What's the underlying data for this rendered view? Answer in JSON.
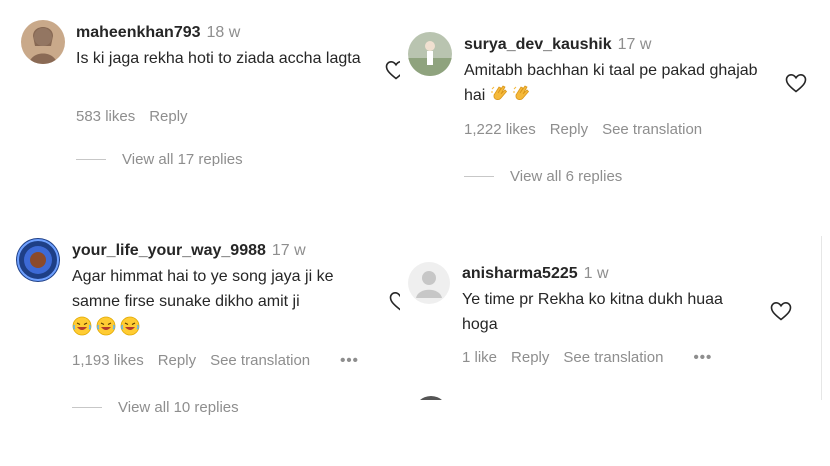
{
  "comments": [
    {
      "username": "maheenkhan793",
      "time": "18 w",
      "text": "Is ki jaga rekha hoti to ziada accha lagta",
      "likes": "583 likes",
      "reply": "Reply",
      "view_replies": "View all 17 replies"
    },
    {
      "username": "surya_dev_kaushik",
      "time": "17 w",
      "text": "Amitabh bachhan ki taal pe pakad ghajab hai",
      "emojis": [
        "clapping-hands-icon",
        "clapping-hands-icon"
      ],
      "likes": "1,222 likes",
      "reply": "Reply",
      "see_translation": "See translation",
      "view_replies": "View all 6 replies"
    },
    {
      "username": "your_life_your_way_9988",
      "time": "17 w",
      "text": "Agar himmat hai to ye song jaya ji ke samne firse sunake dikho amit ji",
      "emojis": [
        "laughing-face-icon",
        "laughing-face-icon",
        "laughing-face-icon"
      ],
      "likes": "1,193 likes",
      "reply": "Reply",
      "see_translation": "See translation",
      "more": "•••",
      "view_replies": "View all 10 replies"
    },
    {
      "username": "anisharma5225",
      "time": "1 w",
      "text": "Ye time pr Rekha ko kitna dukh huaa hoga",
      "likes": "1 like",
      "reply": "Reply",
      "see_translation": "See translation",
      "more": "•••"
    }
  ],
  "colors": {
    "primary_text": "#262626",
    "secondary_text": "#8e8e8e",
    "divider": "#c7c7c7"
  }
}
